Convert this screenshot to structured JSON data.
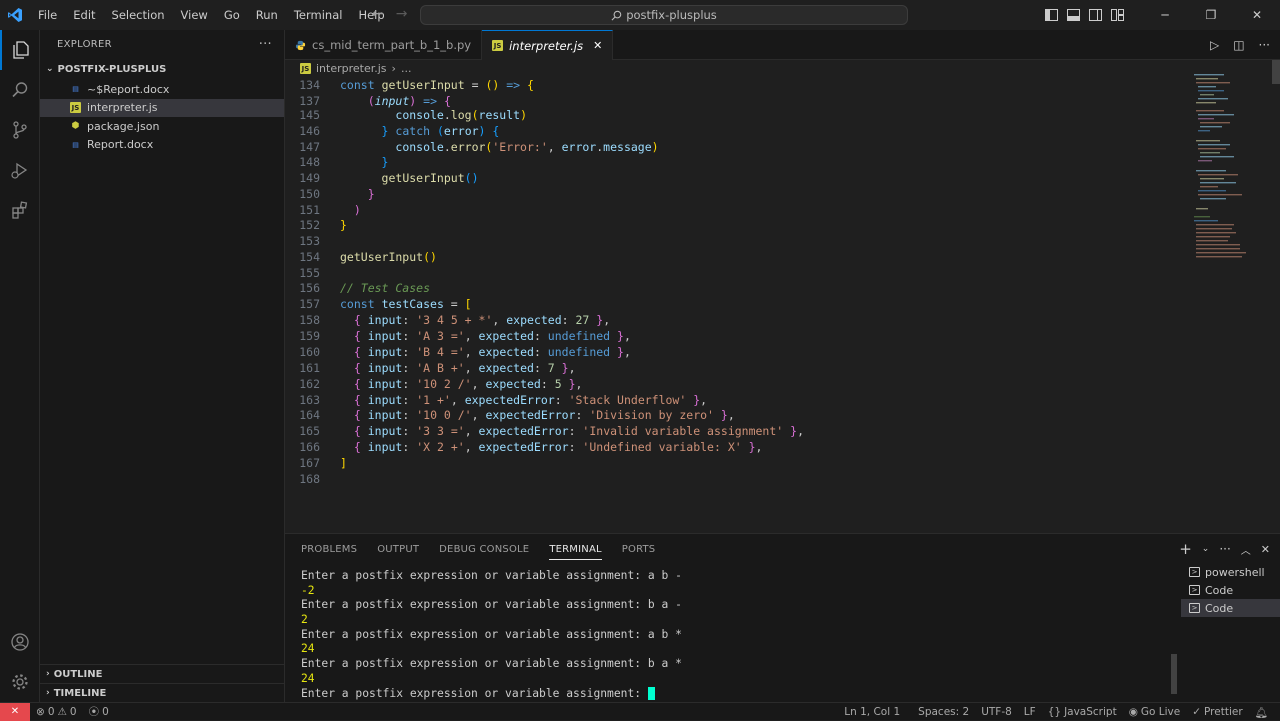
{
  "menu": [
    "File",
    "Edit",
    "Selection",
    "View",
    "Go",
    "Run",
    "Terminal",
    "Help"
  ],
  "search": {
    "text": "postfix-plusplus"
  },
  "sidebar": {
    "title": "EXPLORER",
    "folder": "POSTFIX-PLUSPLUS",
    "files": [
      {
        "name": "~$Report.docx",
        "icon": "word-icon"
      },
      {
        "name": "interpreter.js",
        "icon": "js-icon"
      },
      {
        "name": "package.json",
        "icon": "json-icon"
      },
      {
        "name": "Report.docx",
        "icon": "word-icon"
      }
    ],
    "outline": "OUTLINE",
    "timeline": "TIMELINE"
  },
  "tabs": [
    {
      "label": "cs_mid_term_part_b_1_b.py"
    },
    {
      "label": "interpreter.js"
    }
  ],
  "breadcrumb": {
    "file": "interpreter.js",
    "more": "..."
  },
  "editor": {
    "line_numbers": [
      "134",
      "137",
      "145",
      "146",
      "147",
      "148",
      "149",
      "150",
      "151",
      "152",
      "153",
      "154",
      "155",
      "156",
      "157",
      "158",
      "159",
      "160",
      "161",
      "162",
      "163",
      "164",
      "165",
      "166",
      "167",
      "168"
    ],
    "test_inputs": [
      "'3 4 5 + *'",
      "'A 3 ='",
      "'B 4 ='",
      "'A B +'",
      "'10 2 /'",
      "'1 +'",
      "'10 0 /'",
      "'3 3 ='",
      "'X 2 +'"
    ],
    "test_expected": [
      "27",
      "undefined",
      "undefined",
      "7",
      "5",
      "'Stack Underflow'",
      "'Division by zero'",
      "'Invalid variable assignment'",
      "'Undefined variable: X'"
    ],
    "comment": "// Test Cases",
    "error_label": "'Error:'"
  },
  "panel": {
    "tabs": [
      "PROBLEMS",
      "OUTPUT",
      "DEBUG CONSOLE",
      "TERMINAL",
      "PORTS"
    ],
    "terminal_lines": [
      {
        "text": "Enter a postfix expression or variable assignment: a b -",
        "type": "prompt"
      },
      {
        "text": "-2",
        "type": "out"
      },
      {
        "text": "Enter a postfix expression or variable assignment: b a -",
        "type": "prompt"
      },
      {
        "text": "2",
        "type": "out"
      },
      {
        "text": "Enter a postfix expression or variable assignment: a b *",
        "type": "prompt"
      },
      {
        "text": "24",
        "type": "out"
      },
      {
        "text": "Enter a postfix expression or variable assignment: b a *",
        "type": "prompt"
      },
      {
        "text": "24",
        "type": "out"
      },
      {
        "text": "Enter a postfix expression or variable assignment: ",
        "type": "prompt"
      }
    ],
    "terminals": [
      "powershell",
      "Code",
      "Code"
    ]
  },
  "status": {
    "errors": "0",
    "warnings": "0",
    "ports": "0",
    "position": "Ln 1, Col 1",
    "spaces": "Spaces: 2",
    "encoding": "UTF-8",
    "eol": "LF",
    "language": "JavaScript",
    "live": "Go Live",
    "prettier": "Prettier"
  }
}
